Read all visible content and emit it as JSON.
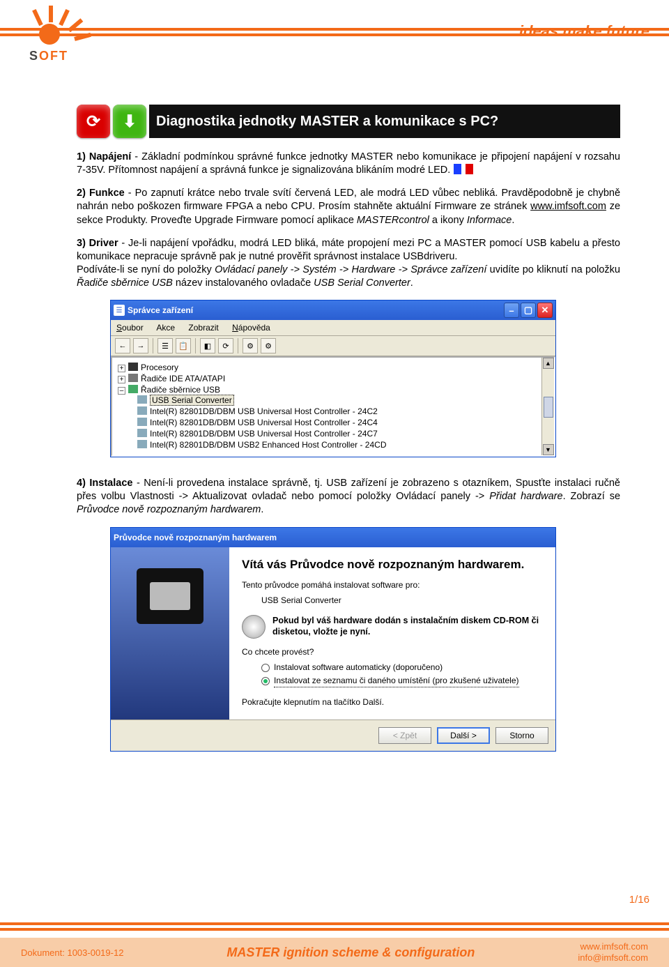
{
  "header": {
    "tagline": "ideas make future",
    "brand_gray": "S",
    "brand_orange": "OFT"
  },
  "title": {
    "heading": "Diagnostika jednotky MASTER a komunikace s PC?"
  },
  "p1": {
    "lead": "1) Napájení",
    "rest": " - Základní podmínkou správné funkce jednotky MASTER nebo komunikace je připojení napájení v rozsahu 7-35V. Přítomnost napájení a správná funkce je signalizována blikáním modré LED. "
  },
  "p2": {
    "lead": "2) Funkce",
    "a": " - Po zapnutí krátce nebo trvale svítí červená LED, ale modrá LED vůbec nebliká. Pravděpodobně je chybně nahrán nebo poškozen firmware FPGA a nebo CPU. Prosím stahněte aktuální Firmware ze stránek ",
    "link": "www.imfsoft.com",
    "b": " ze sekce Produkty. Proveďte Upgrade Firmware pomocí aplikace ",
    "i1": "MASTERcontrol",
    "c": " a ikony ",
    "i2": "Informace",
    "d": "."
  },
  "p3": {
    "lead": "3) Driver",
    "a": " - Je-li napájení vpořádku, modrá LED bliká, máte propojení mezi PC a MASTER pomocí USB kabelu a přesto komunikace nepracuje správně pak je nutné prověřit správnost instalace USBdriveru.",
    "b": "Podíváte-li se nyní do položky ",
    "i1": "Ovládací panely -> Systém -> Hardware -> Správce zařízení",
    "c": "  uvidíte po kliknutí na položku ",
    "i2": "Řadiče sběrnice USB",
    "d": "  název instalovaného ovladače ",
    "i3": "USB Serial Converter",
    "e": "."
  },
  "dm": {
    "title": "Správce zařízení",
    "menu": {
      "file": "Soubor",
      "action": "Akce",
      "view": "Zobrazit",
      "help": "Nápověda"
    },
    "nodes": {
      "cpu": "Procesory",
      "ide": "Řadiče IDE ATA/ATAPI",
      "usb": "Řadiče sběrnice USB",
      "sel": "USB Serial Converter",
      "c1": "Intel(R) 82801DB/DBM USB Universal Host Controller - 24C2",
      "c2": "Intel(R) 82801DB/DBM USB Universal Host Controller - 24C4",
      "c3": "Intel(R) 82801DB/DBM USB Universal Host Controller - 24C7",
      "c4": "Intel(R) 82801DB/DBM USB2 Enhanced Host Controller - 24CD"
    }
  },
  "p4": {
    "lead": "4) Instalace",
    "a": " - Není-li provedena instalace správně, tj. USB zařízení je zobrazeno s otazníkem, Spusťte instalaci ručně přes volbu Vlastnosti -> Aktualizovat ovladač nebo pomocí položky Ovládací panely -> ",
    "i1": "Přidat hardware",
    "b": ". Zobrazí se ",
    "i2": "Průvodce nově rozpoznaným hardwarem",
    "c": "."
  },
  "wz": {
    "title": "Průvodce nově rozpoznaným hardwarem",
    "h": "Vítá vás Průvodce nově rozpoznaným hardwarem.",
    "sub": "Tento průvodce pomáhá instalovat software pro:",
    "device": "USB Serial Converter",
    "cd": "Pokud byl váš hardware dodán s instalačním diskem CD-ROM či disketou, vložte je nyní.",
    "ask": "Co chcete provést?",
    "opt1": "Instalovat software automaticky (doporučeno)",
    "opt2": "Instalovat ze seznamu či daného umístění (pro zkušené uživatele)",
    "cont": "Pokračujte klepnutím na tlačítko Další.",
    "back": "< Zpět",
    "next": "Další >",
    "cancel": "Storno"
  },
  "page_num": "1/16",
  "footer": {
    "docid": "Dokument: 1003-0019-12",
    "mid": "MASTER ignition scheme & configuration",
    "url": "www.imfsoft.com",
    "mail": "info@imfsoft.com"
  }
}
